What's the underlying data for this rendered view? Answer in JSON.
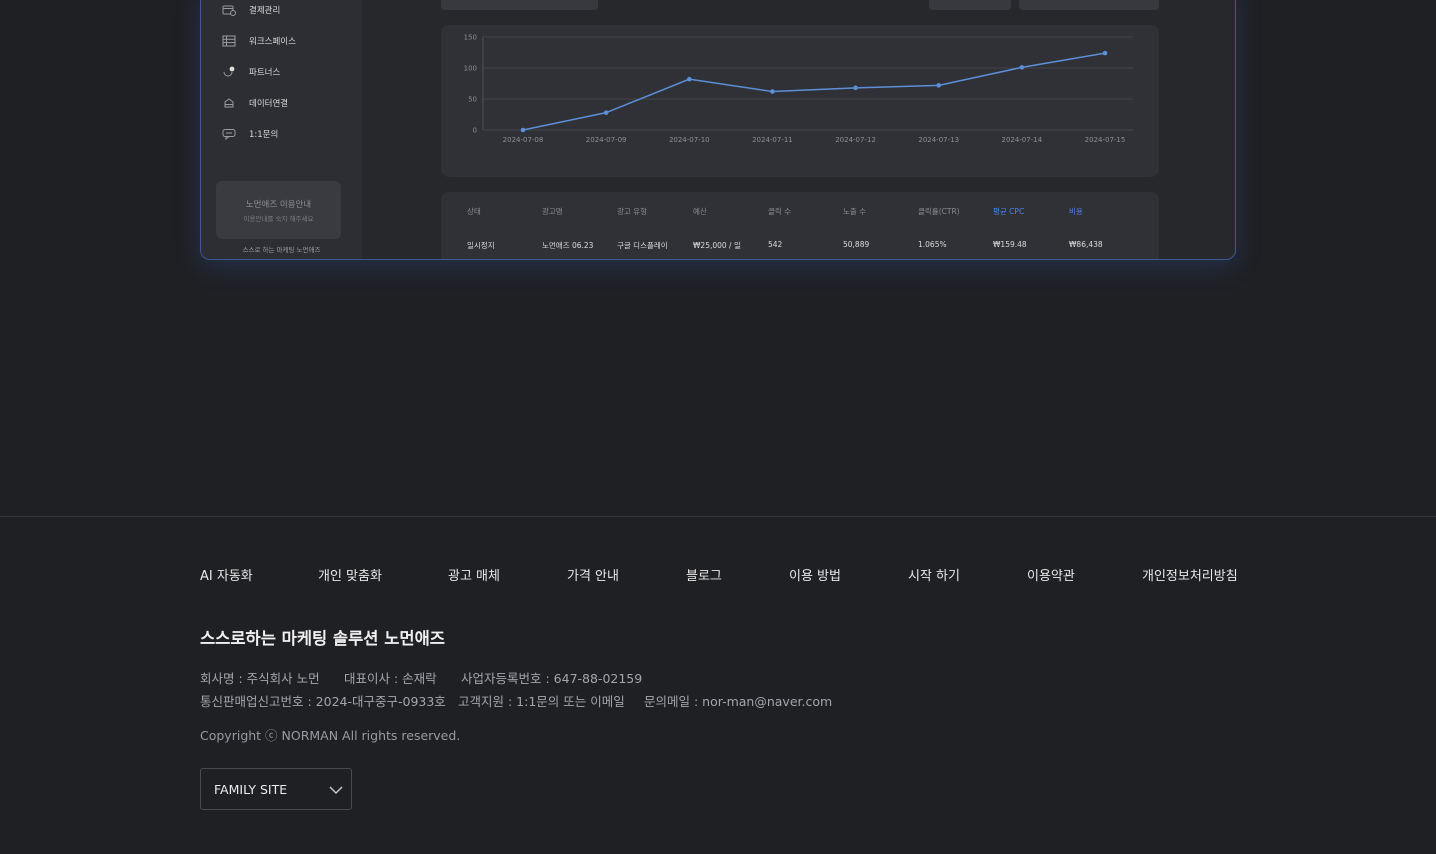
{
  "sidebar": {
    "items": [
      {
        "label": "결제관리",
        "icon": "card-icon"
      },
      {
        "label": "워크스페이스",
        "icon": "list-icon"
      },
      {
        "label": "파트너스",
        "icon": "partner-icon"
      },
      {
        "label": "데이터연결",
        "icon": "database-icon"
      },
      {
        "label": "1:1문의",
        "icon": "chat-icon"
      }
    ],
    "guide_title": "노먼애즈 이용안내",
    "guide_sub": "이용안내를 숙지 해주세요",
    "footer_text": "스스로 하는 마케팅 노먼애즈"
  },
  "chart_data": {
    "type": "line",
    "x": [
      "2024-07-08",
      "2024-07-09",
      "2024-07-10",
      "2024-07-11",
      "2024-07-12",
      "2024-07-13",
      "2024-07-14",
      "2024-07-15"
    ],
    "series": [
      {
        "values": [
          0,
          28,
          82,
          62,
          68,
          72,
          101,
          124
        ]
      }
    ],
    "ylim": [
      0,
      150
    ],
    "yticks": [
      0,
      50,
      100,
      150
    ],
    "grid": true,
    "color": "#5b8fd8"
  },
  "table": {
    "headers": [
      "상태",
      "광고명",
      "광고 유형",
      "예산",
      "클릭 수",
      "노출 수",
      "클릭률(CTR)",
      "평균 CPC",
      "비용"
    ],
    "row": [
      "일시정지",
      "노먼애즈 06.23",
      "구글 디스플레이",
      "₩25,000 / 일",
      "542",
      "50,889",
      "1.065%",
      "₩159.48",
      "₩86,438"
    ],
    "accent_color": "#4d86f0"
  },
  "footer": {
    "nav": [
      "AI 자동화",
      "개인 맞춤화",
      "광고 매체",
      "가격 안내",
      "블로그",
      "이용 방법",
      "시작 하기",
      "이용약관",
      "개인정보처리방침"
    ],
    "brand": "스스로하는 마케팅 솔루션 노먼애즈",
    "company": "회사명 : 주식회사 노먼",
    "ceo": "대표이사 : 손재락",
    "biz_no": "사업자등록번호 : 647-88-02159",
    "mail_order_no": "통신판매업신고번호 : 2024-대구중구-0933호",
    "support": "고객지원 : 1:1문의 또는 이메일",
    "email": "문의메일 : nor-man@naver.com",
    "copyright": "Copyright ⓒ NORMAN All rights reserved.",
    "family_site": "FAMILY SITE"
  }
}
